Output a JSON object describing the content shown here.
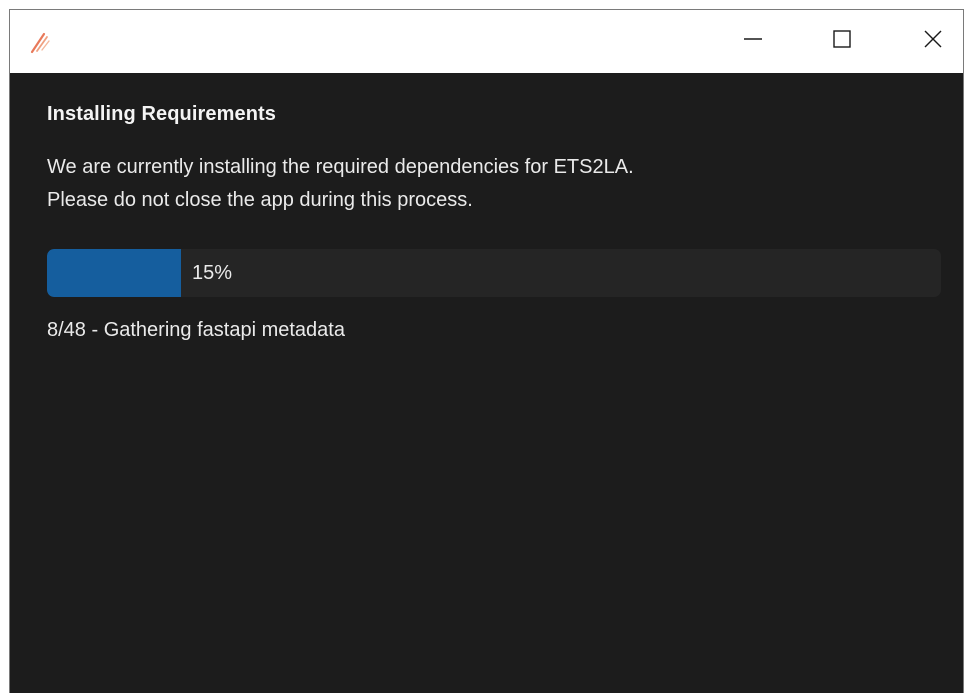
{
  "window": {
    "icon": "ets2la-app-icon",
    "controls": {
      "minimize_icon": "minimize-icon",
      "maximize_icon": "maximize-icon",
      "close_icon": "close-icon"
    }
  },
  "content": {
    "heading": "Installing Requirements",
    "description_line1": "We are currently installing the required dependencies for ETS2LA.",
    "description_line2": "Please do not close the app during this process.",
    "progress": {
      "value": 0.15,
      "label": "15%",
      "fill_color": "#155e9e"
    },
    "status": "8/48 - Gathering fastapi metadata"
  }
}
